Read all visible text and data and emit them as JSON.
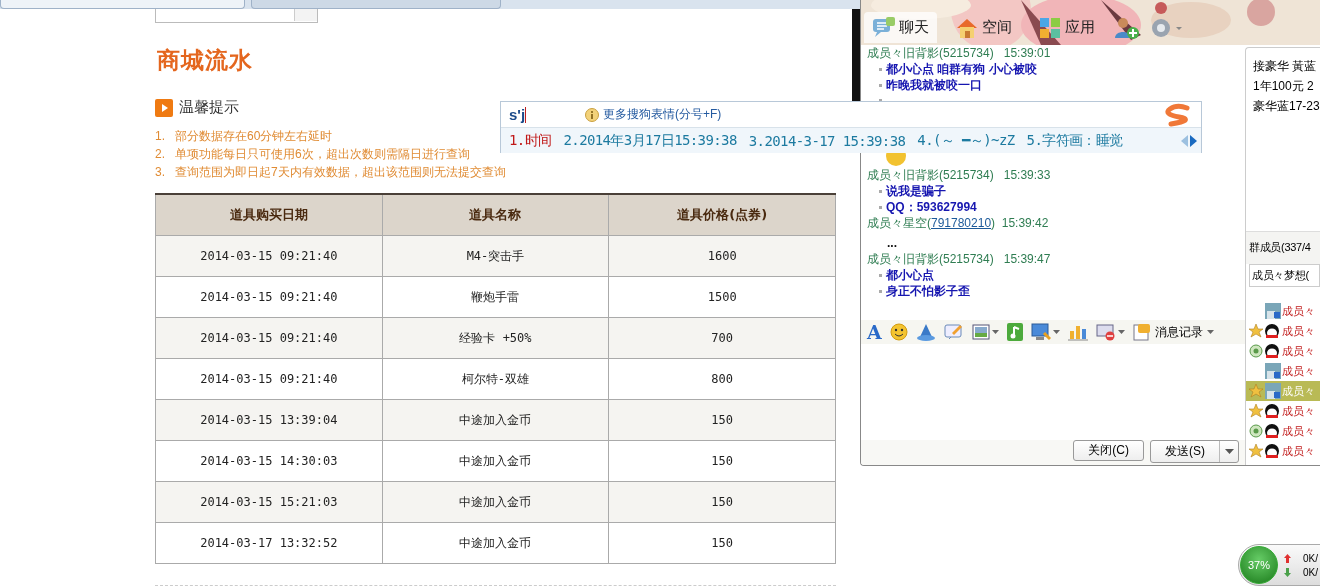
{
  "shop": {
    "title": "商城流水",
    "tips_heading": "温馨提示",
    "tips": [
      {
        "number": "1.",
        "text": "部分数据存在60分钟左右延时"
      },
      {
        "number": "2.",
        "text": "单项功能每日只可使用6次，超出次数则需隔日进行查询"
      },
      {
        "number": "3.",
        "text": "查询范围为即日起7天内有效数据，超出该范围则无法提交查询"
      }
    ],
    "table": {
      "columns": [
        "道具购买日期",
        "道具名称",
        "道具价格(点券)"
      ],
      "rows": [
        [
          "2014-03-15 09:21:40",
          "M4-突击手",
          "1600"
        ],
        [
          "2014-03-15 09:21:40",
          "鞭炮手雷",
          "1500"
        ],
        [
          "2014-03-15 09:21:40",
          "经验卡 +50%",
          "700"
        ],
        [
          "2014-03-15 09:21:40",
          "柯尔特-双雄",
          "800"
        ],
        [
          "2014-03-15 13:39:04",
          "中途加入金币",
          "150"
        ],
        [
          "2014-03-15 14:30:03",
          "中途加入金币",
          "150"
        ],
        [
          "2014-03-15 15:21:03",
          "中途加入金币",
          "150"
        ],
        [
          "2014-03-17 13:32:52",
          "中途加入金币",
          "150"
        ]
      ]
    }
  },
  "qq": {
    "tabs": [
      {
        "label": "聊天",
        "selected": true
      },
      {
        "label": "空间",
        "selected": false
      },
      {
        "label": "应用",
        "selected": false
      }
    ],
    "messages": [
      {
        "kind": "header",
        "sender": "成员々旧背影(5215734)",
        "time": "15:39:01"
      },
      {
        "kind": "bullet",
        "text": "都小心点 咱群有狗  小心被咬"
      },
      {
        "kind": "bullet",
        "text": "昨晚我就被咬一口"
      },
      {
        "kind": "dot"
      },
      {
        "kind": "emoji"
      },
      {
        "kind": "header",
        "sender": "成员々旧背影(5215734)",
        "time": "15:39:33"
      },
      {
        "kind": "bullet",
        "text": "说我是骗子"
      },
      {
        "kind": "bullet",
        "text": "QQ：593627994"
      },
      {
        "kind": "link_header",
        "sender": "成员々星空(",
        "link": "791780210",
        "sender_end": ")",
        "time": "15:39:42"
      },
      {
        "kind": "plain",
        "text": "..."
      },
      {
        "kind": "header",
        "sender": "成员々旧背影(5215734)",
        "time": "15:39:47"
      },
      {
        "kind": "bullet",
        "text": "都小心点"
      },
      {
        "kind": "bullet",
        "text": "身正不怕影子歪"
      }
    ],
    "font_button": "A",
    "history_label": "消息记录",
    "close_button": "关闭(C)",
    "send_button": "发送(S)",
    "notice": [
      "接豪华 黃蓝",
      "1年100元 2",
      "豪华蓝17-23"
    ],
    "members_heading": "群成员(337/4",
    "member_search": "成员々梦想(",
    "members": [
      {
        "name": "成员々",
        "selected": false
      },
      {
        "name": "成员々",
        "kind": "star_penguin",
        "selected": false
      },
      {
        "name": "成员々",
        "kind": "chat_penguin",
        "selected": false
      },
      {
        "name": "成员々",
        "selected": false
      },
      {
        "name": "成员々",
        "kind": "star_photo",
        "selected": true
      },
      {
        "name": "成员々",
        "kind": "star_penguin",
        "selected": false
      },
      {
        "name": "成员々",
        "kind": "chat_penguin",
        "selected": false
      },
      {
        "name": "成员々",
        "kind": "star_penguin",
        "selected": false
      }
    ]
  },
  "ime": {
    "input": "s'j",
    "hint": "更多搜狗表情(分号+F)",
    "candidates": [
      {
        "text": "1.时间",
        "selected": true
      },
      {
        "text": "2.2014年3月17日15:39:38",
        "selected": false
      },
      {
        "text": "3.2014-3-17 15:39:38",
        "selected": false
      },
      {
        "text": "4.(～ ━～)~zZ",
        "selected": false
      },
      {
        "text": "5.字符画：睡觉",
        "selected": false
      }
    ]
  },
  "net": {
    "percent": "37%",
    "upload": "0K/",
    "download": "0K/"
  }
}
